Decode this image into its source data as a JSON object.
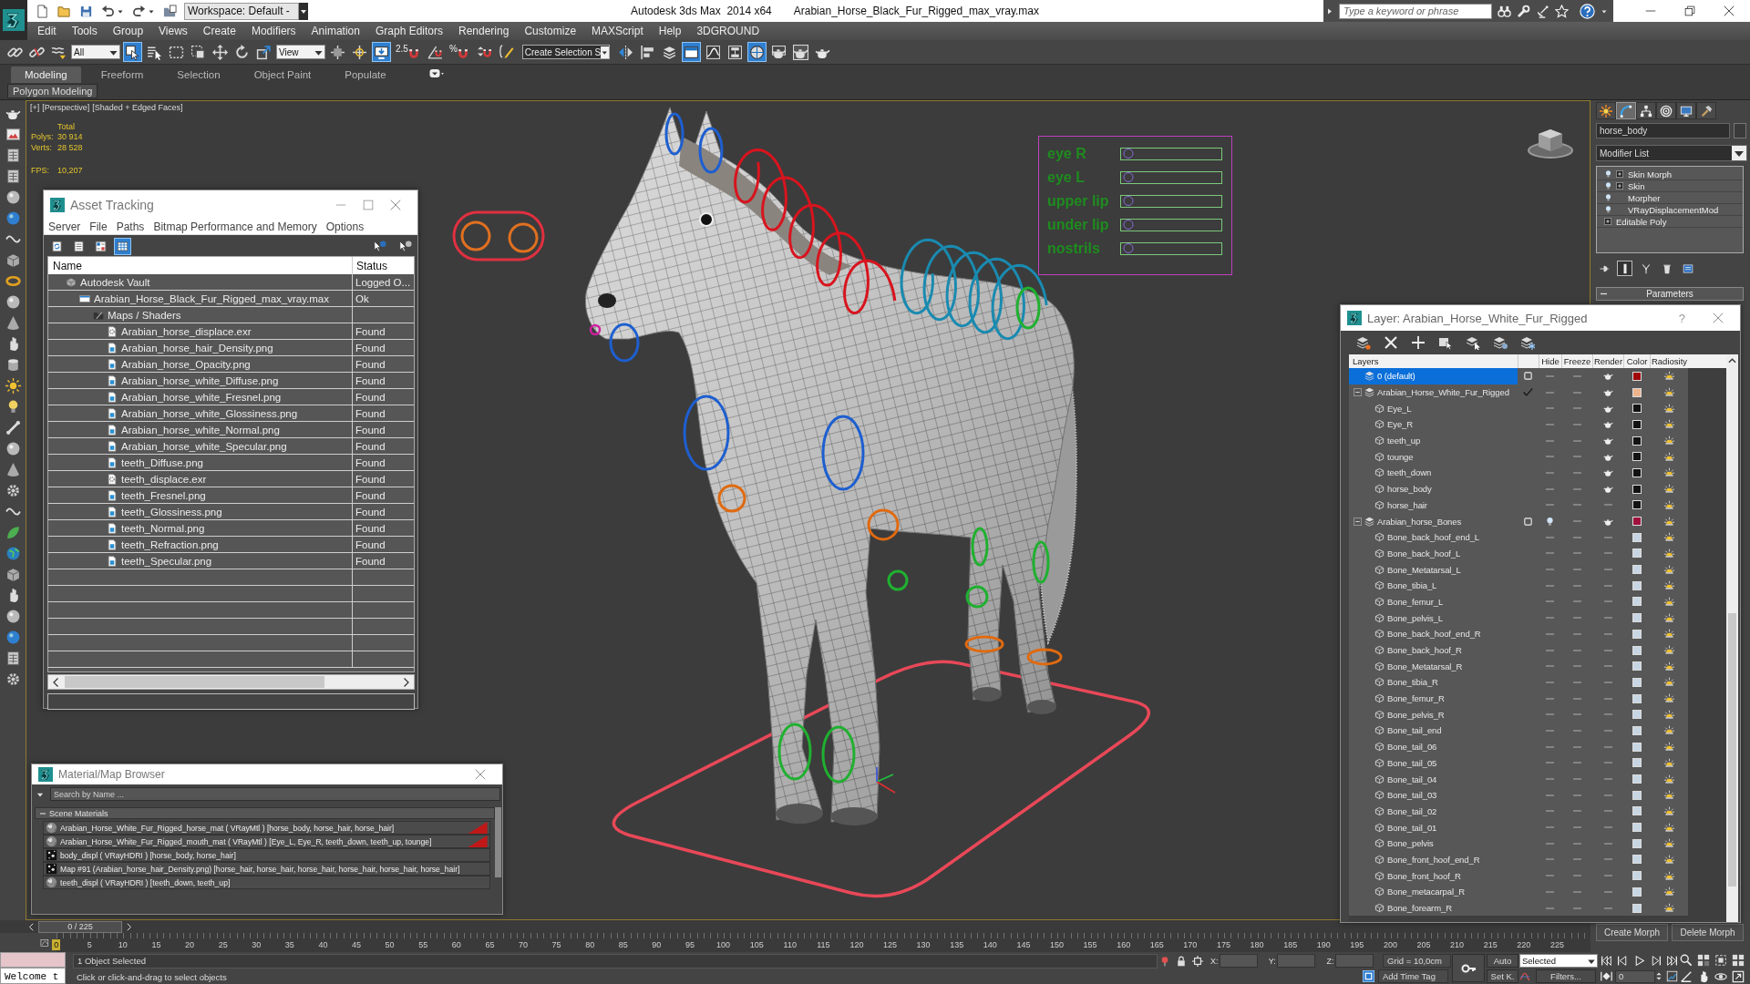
{
  "title_bar": {
    "workspace": "Workspace: Default -",
    "app_title": "Autodesk 3ds Max  2014 x64",
    "file_title": "Arabian_Horse_Black_Fur_Rigged_max_vray.max",
    "search": {
      "placeholder": "Type a keyword or phrase"
    }
  },
  "menu": [
    "Edit",
    "Tools",
    "Group",
    "Views",
    "Create",
    "Modifiers",
    "Animation",
    "Graph Editors",
    "Rendering",
    "Customize",
    "MAXScript",
    "Help",
    "3DGROUND"
  ],
  "main_toolbar": {
    "tools": [
      {
        "kind": "link",
        "on": false
      },
      {
        "kind": "unlink",
        "on": false
      },
      {
        "kind": "bind",
        "on": false
      },
      {
        "kind": "dropdown",
        "value": "All"
      },
      {
        "kind": "select",
        "on": true
      },
      {
        "kind": "selname",
        "on": false
      },
      {
        "kind": "rect",
        "on": false
      },
      {
        "kind": "window",
        "on": false
      },
      {
        "kind": "move",
        "on": false
      },
      {
        "kind": "rotate",
        "on": false
      },
      {
        "kind": "scale",
        "on": false
      },
      {
        "kind": "dropdown",
        "value": "View"
      },
      {
        "kind": "pivot",
        "on": false
      },
      {
        "kind": "manip",
        "on": false
      },
      {
        "kind": "keyb",
        "on": true
      },
      {
        "kind": "snap",
        "on": false,
        "label": "2.5"
      },
      {
        "kind": "angle",
        "on": false
      },
      {
        "kind": "snap",
        "on": false,
        "label": "%"
      },
      {
        "kind": "spinner",
        "on": false
      },
      {
        "kind": "named",
        "on": false
      },
      {
        "kind": "field",
        "value": "Create Selection S"
      },
      {
        "kind": "mirror",
        "on": false
      },
      {
        "kind": "align",
        "on": false
      },
      {
        "kind": "layers",
        "on": false
      },
      {
        "kind": "ribbon",
        "on": true
      },
      {
        "kind": "curve",
        "on": false
      },
      {
        "kind": "schem",
        "on": false
      },
      {
        "kind": "material",
        "on": true
      },
      {
        "kind": "rsetup",
        "on": false
      },
      {
        "kind": "rframe",
        "on": false
      },
      {
        "kind": "render",
        "on": false
      }
    ]
  },
  "ribbon": {
    "tabs": [
      {
        "label": "Modeling",
        "selected": true
      },
      {
        "label": "Freeform",
        "selected": false
      },
      {
        "label": "Selection",
        "selected": false
      },
      {
        "label": "Object Paint",
        "selected": false
      },
      {
        "label": "Populate",
        "selected": false
      }
    ],
    "panel": "Polygon Modeling"
  },
  "viewport": {
    "labels": [
      "[+]",
      "[Perspective]",
      "[Shaded + Edged Faces]"
    ],
    "stats": {
      "heading": "Total",
      "rows": [
        {
          "label": "Polys:",
          "value": "30 914"
        },
        {
          "label": "Verts:",
          "value": "28 528"
        }
      ],
      "fps": {
        "label": "FPS:",
        "value": "10,207"
      }
    },
    "morph_sliders": [
      {
        "label": "eye R",
        "level": 0
      },
      {
        "label": "eye L",
        "level": 0
      },
      {
        "label": "upper lip",
        "level": 0
      },
      {
        "label": "under lip",
        "level": 0
      },
      {
        "label": "nostrils",
        "level": 0
      }
    ]
  },
  "asset_tracking": {
    "title": "Asset Tracking",
    "menu": [
      "Server",
      "File",
      "Paths",
      "Bitmap Performance and Memory",
      "Options"
    ],
    "toolbar": [
      {
        "kind": "refresh",
        "on": false
      },
      {
        "kind": "list",
        "on": false
      },
      {
        "kind": "thumbs",
        "on": false
      },
      {
        "kind": "table",
        "on": true
      }
    ],
    "columns": [
      "Name",
      "Status"
    ],
    "tree": [
      {
        "name": "Autodesk Vault",
        "status": "Logged O...",
        "kind": "vault",
        "children": [
          {
            "name": "Arabian_Horse_Black_Fur_Rigged_max_vray.max",
            "status": "Ok",
            "kind": "scene",
            "children": [
              {
                "name": "Maps / Shaders",
                "kind": "folder",
                "children": [
                  {
                    "name": "Arabian_horse_displace.exr",
                    "status": "Found",
                    "kind": "exr"
                  },
                  {
                    "name": "Arabian_horse_hair_Density.png",
                    "status": "Found",
                    "kind": "bitmap"
                  },
                  {
                    "name": "Arabian_horse_Opacity.png",
                    "status": "Found",
                    "kind": "bitmap"
                  },
                  {
                    "name": "Arabian_horse_white_Diffuse.png",
                    "status": "Found",
                    "kind": "bitmap"
                  },
                  {
                    "name": "Arabian_horse_white_Fresnel.png",
                    "status": "Found",
                    "kind": "bitmap"
                  },
                  {
                    "name": "Arabian_horse_white_Glossiness.png",
                    "status": "Found",
                    "kind": "bitmap"
                  },
                  {
                    "name": "Arabian_horse_white_Normal.png",
                    "status": "Found",
                    "kind": "bitmap"
                  },
                  {
                    "name": "Arabian_horse_white_Specular.png",
                    "status": "Found",
                    "kind": "bitmap"
                  },
                  {
                    "name": "teeth_Diffuse.png",
                    "status": "Found",
                    "kind": "bitmap"
                  },
                  {
                    "name": "teeth_displace.exr",
                    "status": "Found",
                    "kind": "exr"
                  },
                  {
                    "name": "teeth_Fresnel.png",
                    "status": "Found",
                    "kind": "bitmap"
                  },
                  {
                    "name": "teeth_Glossiness.png",
                    "status": "Found",
                    "kind": "bitmap"
                  },
                  {
                    "name": "teeth_Normal.png",
                    "status": "Found",
                    "kind": "bitmap"
                  },
                  {
                    "name": "teeth_Refraction.png",
                    "status": "Found",
                    "kind": "bitmap"
                  },
                  {
                    "name": "teeth_Specular.png",
                    "status": "Found",
                    "kind": "bitmap"
                  }
                ]
              }
            ]
          }
        ]
      }
    ]
  },
  "layers": {
    "title": "Layer: Arabian_Horse_White_Fur_Rigged",
    "help": "?",
    "columns": [
      "Layers",
      "Hide",
      "Freeze",
      "Render",
      "Color",
      "Radiosity"
    ],
    "items": [
      {
        "name": "0 (default)",
        "selected": true,
        "current": false,
        "hidden": false,
        "renderable": true,
        "color": "#a00808"
      },
      {
        "name": "Arabian_Horse_White_Fur_Rigged",
        "selected": false,
        "current": true,
        "expanded": true,
        "hidden": false,
        "renderable": true,
        "color": "#f0b48c",
        "children": [
          {
            "name": "Eye_L",
            "selected": false,
            "renderable": true,
            "color": "#121212"
          },
          {
            "name": "Eye_R",
            "selected": false,
            "renderable": true,
            "color": "#121212"
          },
          {
            "name": "teeth_up",
            "selected": false,
            "renderable": true,
            "color": "#121212"
          },
          {
            "name": "tounge",
            "selected": false,
            "renderable": true,
            "color": "#121212"
          },
          {
            "name": "teeth_down",
            "selected": false,
            "renderable": true,
            "color": "#121212"
          },
          {
            "name": "horse_body",
            "selected": false,
            "renderable": true,
            "color": "#121212"
          },
          {
            "name": "horse_hair",
            "selected": false,
            "renderable": false,
            "color": "#121212"
          }
        ]
      },
      {
        "name": "Arabian_horse_Bones",
        "selected": false,
        "current": false,
        "expanded": true,
        "hidden": true,
        "renderable": true,
        "color": "#a0103c",
        "children": [
          {
            "name": "Bone_back_hoof_end_L",
            "selected": false,
            "renderable": false,
            "color": "#c8d6e4"
          },
          {
            "name": "Bone_back_hoof_L",
            "selected": false,
            "renderable": false,
            "color": "#c8d6e4"
          },
          {
            "name": "Bone_Metatarsal_L",
            "selected": false,
            "renderable": false,
            "color": "#c8d6e4"
          },
          {
            "name": "Bone_tibia_L",
            "selected": false,
            "renderable": false,
            "color": "#c8d6e4"
          },
          {
            "name": "Bone_femur_L",
            "selected": false,
            "renderable": false,
            "color": "#c8d6e4"
          },
          {
            "name": "Bone_pelvis_L",
            "selected": false,
            "renderable": false,
            "color": "#c8d6e4"
          },
          {
            "name": "Bone_back_hoof_end_R",
            "selected": false,
            "renderable": false,
            "color": "#c8d6e4"
          },
          {
            "name": "Bone_back_hoof_R",
            "selected": false,
            "renderable": false,
            "color": "#c8d6e4"
          },
          {
            "name": "Bone_Metatarsal_R",
            "selected": false,
            "renderable": false,
            "color": "#c8d6e4"
          },
          {
            "name": "Bone_tibia_R",
            "selected": false,
            "renderable": false,
            "color": "#c8d6e4"
          },
          {
            "name": "Bone_femur_R",
            "selected": false,
            "renderable": false,
            "color": "#c8d6e4"
          },
          {
            "name": "Bone_pelvis_R",
            "selected": false,
            "renderable": false,
            "color": "#c8d6e4"
          },
          {
            "name": "Bone_tail_end",
            "selected": false,
            "renderable": false,
            "color": "#c8d6e4"
          },
          {
            "name": "Bone_tail_06",
            "selected": false,
            "renderable": false,
            "color": "#c8d6e4"
          },
          {
            "name": "Bone_tail_05",
            "selected": false,
            "renderable": false,
            "color": "#c8d6e4"
          },
          {
            "name": "Bone_tail_04",
            "selected": false,
            "renderable": false,
            "color": "#c8d6e4"
          },
          {
            "name": "Bone_tail_03",
            "selected": false,
            "renderable": false,
            "color": "#c8d6e4"
          },
          {
            "name": "Bone_tail_02",
            "selected": false,
            "renderable": false,
            "color": "#c8d6e4"
          },
          {
            "name": "Bone_tail_01",
            "selected": false,
            "renderable": false,
            "color": "#c8d6e4"
          },
          {
            "name": "Bone_pelvis",
            "selected": false,
            "renderable": false,
            "color": "#c8d6e4"
          },
          {
            "name": "Bone_front_hoof_end_R",
            "selected": false,
            "renderable": false,
            "color": "#c8d6e4"
          },
          {
            "name": "Bone_front_hoof_R",
            "selected": false,
            "renderable": false,
            "color": "#c8d6e4"
          },
          {
            "name": "Bone_metacarpal_R",
            "selected": false,
            "renderable": false,
            "color": "#c8d6e4"
          },
          {
            "name": "Bone_forearm_R",
            "selected": false,
            "renderable": false,
            "color": "#c8d6e4"
          }
        ]
      }
    ]
  },
  "material_browser": {
    "title": "Material/Map Browser",
    "search": {
      "placeholder": "Search by Name ..."
    },
    "group": {
      "title": "Scene Materials",
      "expanded": true,
      "items": [
        {
          "name": "Arabian_Horse_White_Fur_Rigged_horse_mat ( VRayMtl ) [horse_body, horse_hair, horse_hair]",
          "kind": "material",
          "assigned": true
        },
        {
          "name": "Arabian_Horse_White_Fur_Rigged_mouth_mat ( VRayMtl ) [Eye_L, Eye_R, teeth_down, teeth_up, tounge]",
          "kind": "material",
          "assigned": true
        },
        {
          "name": "body_displ ( VRayHDRI ) [horse_body, horse_hair]",
          "kind": "map",
          "assigned": false
        },
        {
          "name": "Map #91 (Arabian_horse_hair_Density.png) [horse_hair, horse_hair, horse_hair, horse_hair, horse_hair, horse_hair]",
          "kind": "map",
          "assigned": false
        },
        {
          "name": "teeth_displ ( VRayHDRI ) [teeth_down, teeth_up]",
          "kind": "material",
          "assigned": false
        }
      ]
    }
  },
  "command_panel": {
    "tabs": [
      {
        "kind": "create",
        "selected": false
      },
      {
        "kind": "modify",
        "selected": true
      },
      {
        "kind": "hierarchy",
        "selected": false
      },
      {
        "kind": "motion",
        "selected": false
      },
      {
        "kind": "display",
        "selected": false
      },
      {
        "kind": "utilities",
        "selected": false
      }
    ],
    "object_name": "horse_body",
    "modifier_list": "Modifier List",
    "stack": [
      {
        "name": "Skin Morph",
        "kind": "modifier",
        "expandable": true
      },
      {
        "name": "Skin",
        "kind": "modifier",
        "expandable": true
      },
      {
        "name": "Morpher",
        "kind": "modifier",
        "expandable": false
      },
      {
        "name": "VRayDisplacementMod",
        "kind": "modifier",
        "expandable": false
      },
      {
        "name": "Editable Poly",
        "kind": "base",
        "expandable": true
      }
    ],
    "stack_tools": [
      {
        "kind": "pin",
        "on": false
      },
      {
        "kind": "endresult",
        "on": true
      },
      {
        "kind": "unique",
        "on": false
      },
      {
        "kind": "remove",
        "on": false
      },
      {
        "kind": "configure",
        "on": false
      }
    ],
    "rollout": "Parameters",
    "buttons": [
      "Create Morph",
      "Delete Morph"
    ]
  },
  "timeline": {
    "frame": "0 / 225",
    "ticks": [
      "0",
      "5",
      "10",
      "15",
      "20",
      "25",
      "30",
      "35",
      "40",
      "45",
      "50",
      "55",
      "60",
      "65",
      "70",
      "75",
      "80",
      "85",
      "90",
      "95",
      "100",
      "105",
      "110",
      "115",
      "120",
      "125",
      "130",
      "135",
      "140",
      "145",
      "150",
      "155",
      "160",
      "165",
      "170",
      "175",
      "180",
      "185",
      "190",
      "195",
      "200",
      "205",
      "210",
      "215",
      "220",
      "225"
    ]
  },
  "status_bar": {
    "listener": "Welcome t",
    "selection": "1 Object Selected",
    "prompt": "Click or click-and-drag to select objects",
    "axes": [
      "X:",
      "Y:",
      "Z:"
    ],
    "grid": "Grid = 10,0cm",
    "time_tag": "Add Time Tag",
    "auto_key": "Auto",
    "key_filter": "Selected",
    "set_key": "Set K.",
    "filters": "Filters...",
    "frame": "0"
  }
}
